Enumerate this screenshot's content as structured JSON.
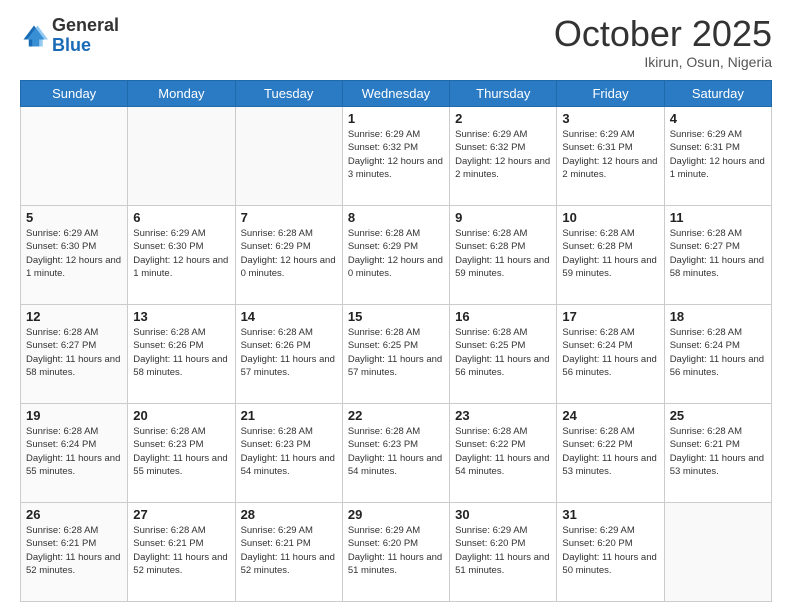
{
  "header": {
    "logo_general": "General",
    "logo_blue": "Blue",
    "month": "October 2025",
    "location": "Ikirun, Osun, Nigeria"
  },
  "weekdays": [
    "Sunday",
    "Monday",
    "Tuesday",
    "Wednesday",
    "Thursday",
    "Friday",
    "Saturday"
  ],
  "weeks": [
    [
      {
        "day": "",
        "info": ""
      },
      {
        "day": "",
        "info": ""
      },
      {
        "day": "",
        "info": ""
      },
      {
        "day": "1",
        "info": "Sunrise: 6:29 AM\nSunset: 6:32 PM\nDaylight: 12 hours and 3 minutes."
      },
      {
        "day": "2",
        "info": "Sunrise: 6:29 AM\nSunset: 6:32 PM\nDaylight: 12 hours and 2 minutes."
      },
      {
        "day": "3",
        "info": "Sunrise: 6:29 AM\nSunset: 6:31 PM\nDaylight: 12 hours and 2 minutes."
      },
      {
        "day": "4",
        "info": "Sunrise: 6:29 AM\nSunset: 6:31 PM\nDaylight: 12 hours and 1 minute."
      }
    ],
    [
      {
        "day": "5",
        "info": "Sunrise: 6:29 AM\nSunset: 6:30 PM\nDaylight: 12 hours and 1 minute."
      },
      {
        "day": "6",
        "info": "Sunrise: 6:29 AM\nSunset: 6:30 PM\nDaylight: 12 hours and 1 minute."
      },
      {
        "day": "7",
        "info": "Sunrise: 6:28 AM\nSunset: 6:29 PM\nDaylight: 12 hours and 0 minutes."
      },
      {
        "day": "8",
        "info": "Sunrise: 6:28 AM\nSunset: 6:29 PM\nDaylight: 12 hours and 0 minutes."
      },
      {
        "day": "9",
        "info": "Sunrise: 6:28 AM\nSunset: 6:28 PM\nDaylight: 11 hours and 59 minutes."
      },
      {
        "day": "10",
        "info": "Sunrise: 6:28 AM\nSunset: 6:28 PM\nDaylight: 11 hours and 59 minutes."
      },
      {
        "day": "11",
        "info": "Sunrise: 6:28 AM\nSunset: 6:27 PM\nDaylight: 11 hours and 58 minutes."
      }
    ],
    [
      {
        "day": "12",
        "info": "Sunrise: 6:28 AM\nSunset: 6:27 PM\nDaylight: 11 hours and 58 minutes."
      },
      {
        "day": "13",
        "info": "Sunrise: 6:28 AM\nSunset: 6:26 PM\nDaylight: 11 hours and 58 minutes."
      },
      {
        "day": "14",
        "info": "Sunrise: 6:28 AM\nSunset: 6:26 PM\nDaylight: 11 hours and 57 minutes."
      },
      {
        "day": "15",
        "info": "Sunrise: 6:28 AM\nSunset: 6:25 PM\nDaylight: 11 hours and 57 minutes."
      },
      {
        "day": "16",
        "info": "Sunrise: 6:28 AM\nSunset: 6:25 PM\nDaylight: 11 hours and 56 minutes."
      },
      {
        "day": "17",
        "info": "Sunrise: 6:28 AM\nSunset: 6:24 PM\nDaylight: 11 hours and 56 minutes."
      },
      {
        "day": "18",
        "info": "Sunrise: 6:28 AM\nSunset: 6:24 PM\nDaylight: 11 hours and 56 minutes."
      }
    ],
    [
      {
        "day": "19",
        "info": "Sunrise: 6:28 AM\nSunset: 6:24 PM\nDaylight: 11 hours and 55 minutes."
      },
      {
        "day": "20",
        "info": "Sunrise: 6:28 AM\nSunset: 6:23 PM\nDaylight: 11 hours and 55 minutes."
      },
      {
        "day": "21",
        "info": "Sunrise: 6:28 AM\nSunset: 6:23 PM\nDaylight: 11 hours and 54 minutes."
      },
      {
        "day": "22",
        "info": "Sunrise: 6:28 AM\nSunset: 6:23 PM\nDaylight: 11 hours and 54 minutes."
      },
      {
        "day": "23",
        "info": "Sunrise: 6:28 AM\nSunset: 6:22 PM\nDaylight: 11 hours and 54 minutes."
      },
      {
        "day": "24",
        "info": "Sunrise: 6:28 AM\nSunset: 6:22 PM\nDaylight: 11 hours and 53 minutes."
      },
      {
        "day": "25",
        "info": "Sunrise: 6:28 AM\nSunset: 6:21 PM\nDaylight: 11 hours and 53 minutes."
      }
    ],
    [
      {
        "day": "26",
        "info": "Sunrise: 6:28 AM\nSunset: 6:21 PM\nDaylight: 11 hours and 52 minutes."
      },
      {
        "day": "27",
        "info": "Sunrise: 6:28 AM\nSunset: 6:21 PM\nDaylight: 11 hours and 52 minutes."
      },
      {
        "day": "28",
        "info": "Sunrise: 6:29 AM\nSunset: 6:21 PM\nDaylight: 11 hours and 52 minutes."
      },
      {
        "day": "29",
        "info": "Sunrise: 6:29 AM\nSunset: 6:20 PM\nDaylight: 11 hours and 51 minutes."
      },
      {
        "day": "30",
        "info": "Sunrise: 6:29 AM\nSunset: 6:20 PM\nDaylight: 11 hours and 51 minutes."
      },
      {
        "day": "31",
        "info": "Sunrise: 6:29 AM\nSunset: 6:20 PM\nDaylight: 11 hours and 50 minutes."
      },
      {
        "day": "",
        "info": ""
      }
    ]
  ]
}
